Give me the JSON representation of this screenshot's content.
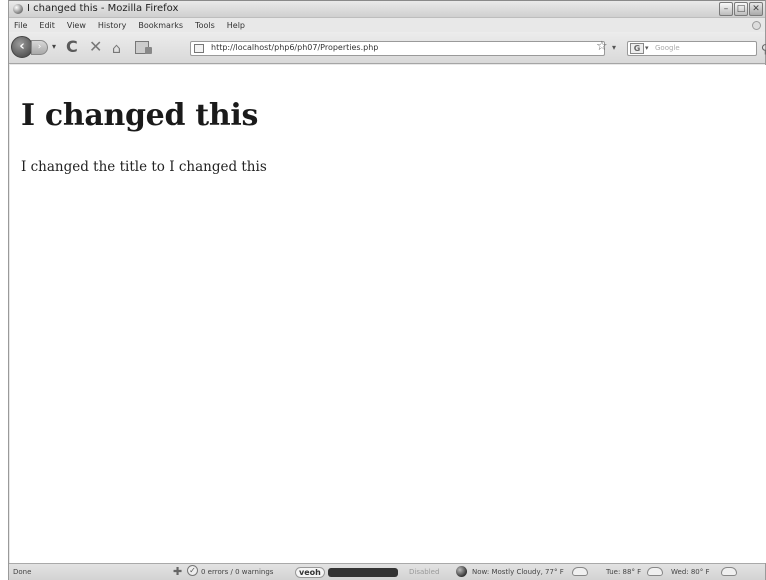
{
  "window": {
    "title": "I changed this - Mozilla Firefox",
    "minimize": "–",
    "maximize": "□",
    "close": "✕"
  },
  "menu": [
    {
      "label": "File"
    },
    {
      "label": "Edit"
    },
    {
      "label": "View"
    },
    {
      "label": "History"
    },
    {
      "label": "Bookmarks"
    },
    {
      "label": "Tools"
    },
    {
      "label": "Help"
    }
  ],
  "nav": {
    "back": "‹",
    "forward": "›",
    "history_dropdown": "▾",
    "reload": "C",
    "stop": "✕",
    "home": "⌂",
    "url": "http://localhost/php6/ph07/Properties.php",
    "star": "☆",
    "url_dropdown": "▾",
    "search_engine": "G",
    "search_engine_dropdown": "▾",
    "search_placeholder": "Google",
    "search_icon": "⚲"
  },
  "page": {
    "heading": "I changed this",
    "paragraph": "I changed the title to I changed this"
  },
  "status": {
    "done": "Done",
    "errors": "0 errors / 0 warnings",
    "veoh": "veoh",
    "disabled": "Disabled",
    "weather_now": "Now: Mostly Cloudy, 77° F",
    "weather_tue": "Tue: 88° F",
    "weather_wed": "Wed: 80° F"
  },
  "icons": {
    "favicon": "firefox-icon",
    "puzzle": "puzzle-icon",
    "check": "check-icon",
    "weather": "weather-globe-icon",
    "cloud": "cloud-icon"
  },
  "colors": {
    "page_bg": "#ffffff",
    "chrome_bg": "#e8e8e8",
    "text": "#222222"
  }
}
